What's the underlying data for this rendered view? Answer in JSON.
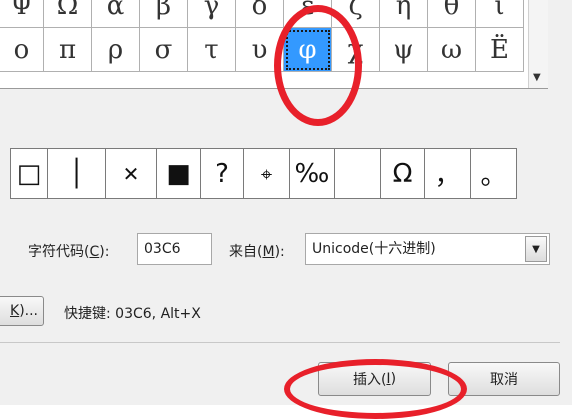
{
  "symbol_grid": {
    "row1": [
      "Ψ",
      "Ω",
      "α",
      "β",
      "γ",
      "δ",
      "ε",
      "ζ",
      "η",
      "θ",
      "ι"
    ],
    "row2": [
      "ο",
      "π",
      "ρ",
      "σ",
      "τ",
      "υ",
      "φ",
      "χ",
      "ψ",
      "ω",
      "Ë"
    ],
    "selected_symbol": "φ"
  },
  "recent_symbols": [
    "□",
    "│",
    "✕",
    "■",
    "?",
    "⌖",
    "‰",
    "",
    "Ω",
    "，",
    "。"
  ],
  "char_code": {
    "label": "字符代码(",
    "key": "C",
    "label_end": "):",
    "value": "03C6"
  },
  "from": {
    "label": "来自(",
    "key": "M",
    "label_end": "):",
    "value": "Unicode(十六进制)"
  },
  "shortcut_key_button": {
    "key": "K",
    "label_end": ")..."
  },
  "shortcut_text": "快捷键: 03C6, Alt+X",
  "buttons": {
    "insert_label": "插入(",
    "insert_key": "I",
    "insert_end": ")",
    "cancel_label": "取消"
  },
  "colors": {
    "selection": "#3399ff",
    "highlight_ring": "#e8202a",
    "dialog_bg": "#f0f0f0"
  },
  "icons": {
    "dropdown_arrow": "dropdown-arrow-icon",
    "scroll_down": "scroll-down-icon"
  }
}
